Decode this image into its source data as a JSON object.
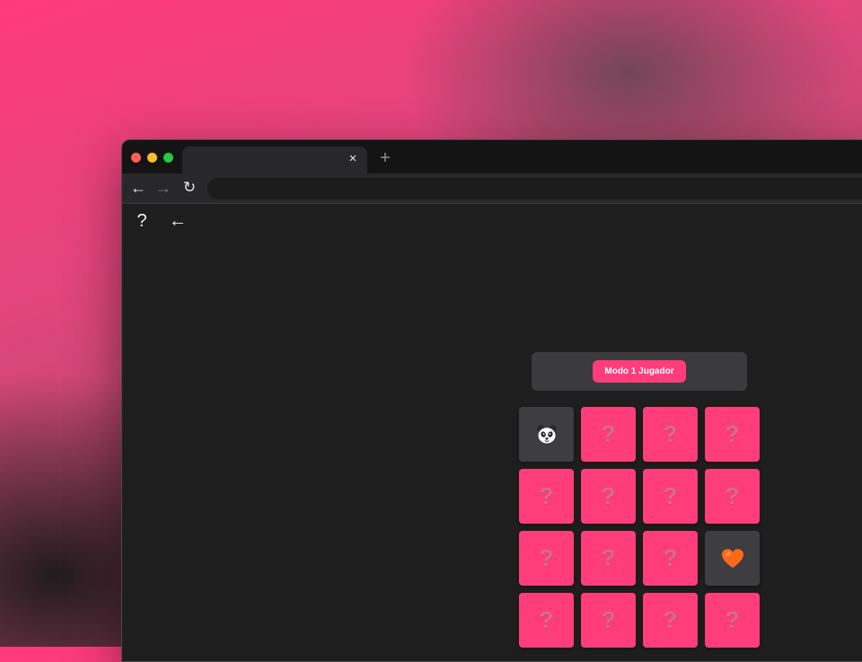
{
  "browser": {
    "traffic_lights": [
      "#ff5f57",
      "#febc2e",
      "#28c840"
    ],
    "tab_close": "×",
    "new_tab": "+",
    "nav": {
      "back": "←",
      "forward": "→",
      "reload": "↻"
    }
  },
  "app": {
    "help_icon": "?",
    "back_icon": "←",
    "mode_label": "Modo 1 Jugador",
    "board": {
      "columns": 4,
      "rows": 4,
      "cards": [
        {
          "state": "revealed",
          "face": "panda-icon"
        },
        {
          "state": "hidden",
          "face": "?"
        },
        {
          "state": "hidden",
          "face": "?"
        },
        {
          "state": "hidden",
          "face": "?"
        },
        {
          "state": "hidden",
          "face": "?"
        },
        {
          "state": "hidden",
          "face": "?"
        },
        {
          "state": "hidden",
          "face": "?"
        },
        {
          "state": "hidden",
          "face": "?"
        },
        {
          "state": "hidden",
          "face": "?"
        },
        {
          "state": "hidden",
          "face": "?"
        },
        {
          "state": "hidden",
          "face": "?"
        },
        {
          "state": "revealed",
          "face": "heart-icon"
        },
        {
          "state": "hidden",
          "face": "?"
        },
        {
          "state": "hidden",
          "face": "?"
        },
        {
          "state": "hidden",
          "face": "?"
        },
        {
          "state": "hidden",
          "face": "?"
        }
      ]
    },
    "colors": {
      "accent": "#ff3d7c",
      "card_hidden": "#ff3d7c",
      "card_revealed": "#3e3e40",
      "page_bg": "#1e1e1f",
      "heart": "#ff6a1a"
    }
  }
}
